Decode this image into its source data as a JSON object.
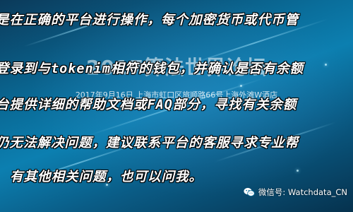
{
  "text_lines": [
    "是在正确的平台进行操作，每个加密货币或代币管",
    "登录到与tokenim相符的钱包，并确认是否有余额",
    "台提供详细的帮助文档或FAQ部分，寻找有关余额",
    "仍无法解决问题，建议联系平台的客服寻求专业帮",
    "有其他相关问题，也可以问我。"
  ],
  "watermark": {
    "title": "2017算法世界论坛",
    "subtitle": "2017年9月16日   上海市虹口区旅顺路66号上海外滩W酒店"
  },
  "credit": {
    "icon": "wechat-icon",
    "text": "微信号: Watchdata_CN"
  },
  "colors": {
    "background_mid": "#0c7fb0",
    "background_dark": "#06324e",
    "text": "#ffffff"
  }
}
